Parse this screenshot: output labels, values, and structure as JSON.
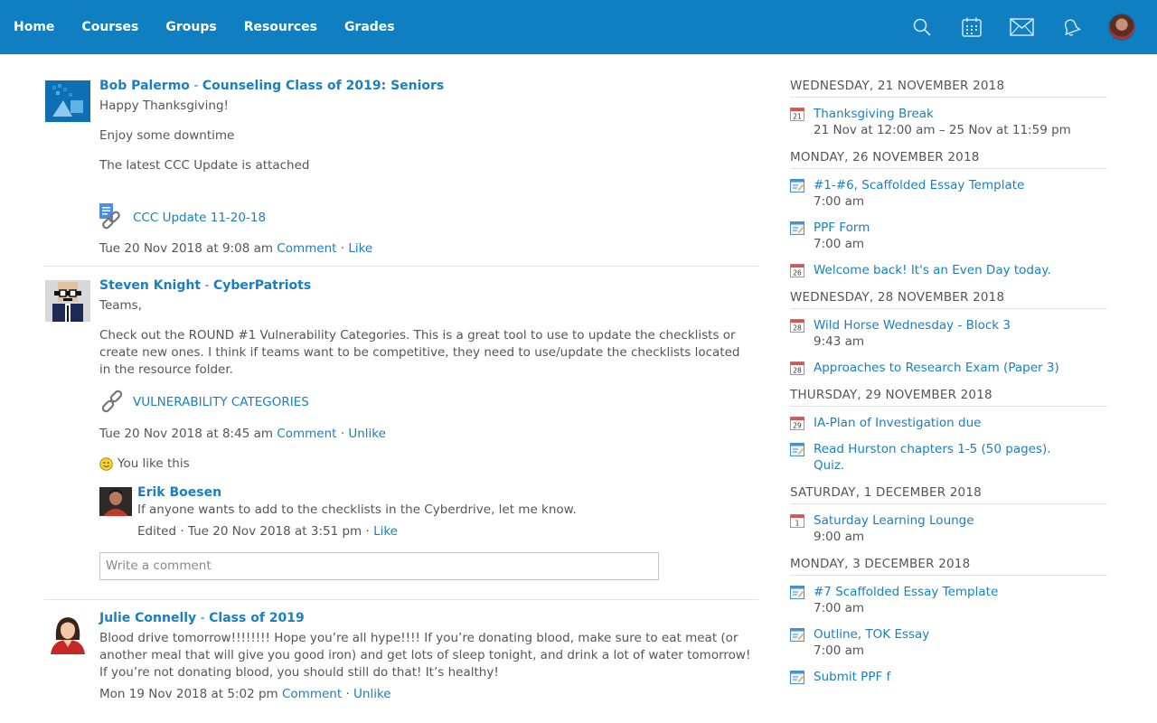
{
  "nav": {
    "items": [
      "Home",
      "Courses",
      "Groups",
      "Resources",
      "Grades"
    ],
    "icons": [
      "search-icon",
      "calendar-icon",
      "mail-icon",
      "notifications-icon"
    ]
  },
  "feed": {
    "post1": {
      "author": "Bob Palermo",
      "group": "Counseling Class of 2019: Seniors",
      "lines": [
        "Happy Thanksgiving!",
        "Enjoy some downtime",
        "The latest CCC Update is attached"
      ],
      "attachment": "CCC Update 11-20-18",
      "date": "Tue 20 Nov 2018 at 9:08 am",
      "comment": "Comment",
      "like": "Like"
    },
    "post2": {
      "author": "Steven Knight",
      "group": "CyberPatriots",
      "line1": "Teams,",
      "line2": "Check out the ROUND #1 Vulnerability Categories. This is a great tool to use to update the checklists or create new ones. I think if teams want to be competitive, they need to use/update the checklists located in the resource folder.",
      "attachment": "VULNERABILITY CATEGORIES",
      "date": "Tue 20 Nov 2018 at 8:45 am",
      "comment": "Comment",
      "unlike": "Unlike",
      "you_like": "You like this",
      "reply": {
        "author": "Erik Boesen",
        "text": "If anyone wants to add to the checklists in the Cyberdrive, let me know.",
        "edited": "Edited",
        "date": "Tue 20 Nov 2018 at 3:51 pm",
        "like": "Like"
      },
      "comment_placeholder": "Write a comment"
    },
    "post3": {
      "author": "Julie Connelly",
      "group": "Class of 2019",
      "text": "Blood drive tomorrow!!!!!!!! Hope you’re all hype!!!! If you’re donating blood, make sure to eat meat (or another meal that will give you good iron) and get lots of sleep tonight, and drink a lot of water tomorrow! If you’re not donating blood, you should still do that! It’s healthy!",
      "date": "Mon 19 Nov 2018 at 5:02 pm",
      "comment": "Comment",
      "unlike": "Unlike"
    }
  },
  "sidebar": {
    "days": [
      {
        "head": "Wednesday, 21 November 2018",
        "events": [
          {
            "icon": "21",
            "type": "calendar",
            "title": "Thanksgiving Break",
            "time": "21 Nov at 12:00 am – 25 Nov at 11:59 pm"
          }
        ]
      },
      {
        "head": "Monday, 26 November 2018",
        "events": [
          {
            "icon": "",
            "type": "assignment",
            "title": "#1-#6, Scaffolded Essay Template",
            "time": "7:00 am"
          },
          {
            "icon": "",
            "type": "assignment",
            "title": "PPF Form",
            "time": "7:00 am"
          },
          {
            "icon": "26",
            "type": "calendar",
            "title": "Welcome back! It's an Even Day today.",
            "time": ""
          }
        ]
      },
      {
        "head": "Wednesday, 28 November 2018",
        "events": [
          {
            "icon": "28",
            "type": "calendar",
            "title": "Wild Horse Wednesday - Block 3",
            "time": "9:43 am"
          },
          {
            "icon": "28",
            "type": "calendar",
            "title": "Approaches to Research Exam (Paper 3)",
            "time": ""
          }
        ]
      },
      {
        "head": "Thursday, 29 November 2018",
        "events": [
          {
            "icon": "29",
            "type": "calendar",
            "title": "IA-Plan of Investigation due",
            "time": ""
          },
          {
            "icon": "",
            "type": "assignment",
            "title": "Read Hurston chapters 1-5 (50 pages). Quiz.",
            "time": ""
          }
        ]
      },
      {
        "head": "Saturday, 1 December 2018",
        "events": [
          {
            "icon": "1",
            "type": "calendar",
            "title": "Saturday Learning Lounge",
            "time": "9:00 am"
          }
        ]
      },
      {
        "head": "Monday, 3 December 2018",
        "events": [
          {
            "icon": "",
            "type": "assignment",
            "title": "#7 Scaffolded Essay Template",
            "time": "7:00 am"
          },
          {
            "icon": "",
            "type": "assignment",
            "title": "Outline, TOK Essay",
            "time": "7:00 am"
          },
          {
            "icon": "",
            "type": "assignment",
            "title": "Submit PPF f",
            "time": ""
          }
        ]
      }
    ]
  },
  "colors": {
    "brand": "#0f7fc2",
    "link": "#1a7fc1",
    "text": "#555555"
  }
}
